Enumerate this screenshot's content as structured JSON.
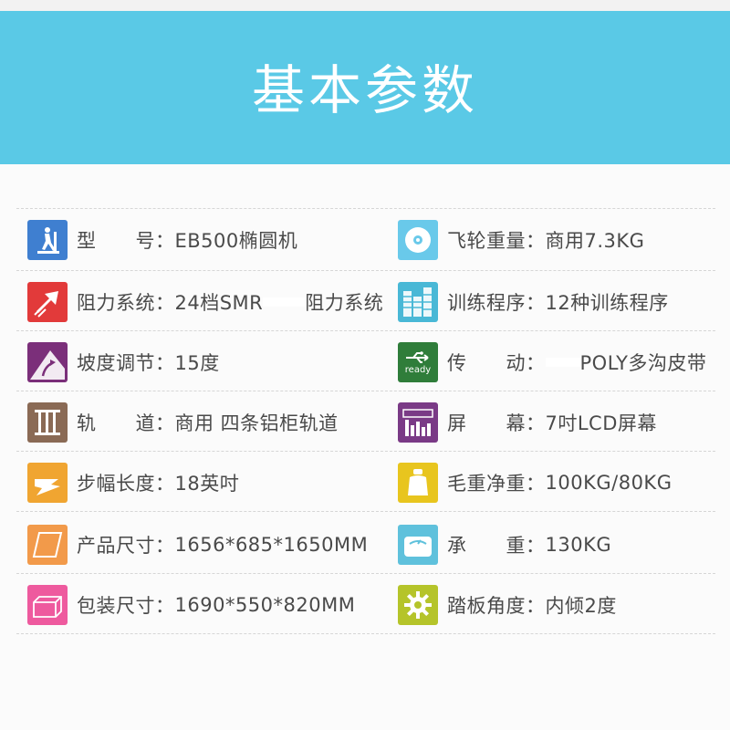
{
  "header": {
    "title": "基本参数"
  },
  "colors": {
    "banner": "#5ac9e6"
  },
  "left": [
    {
      "icon": "elliptical-machine-icon",
      "label": "型　　号：",
      "value": "EB500椭圆机"
    },
    {
      "icon": "resistance-arrow-icon",
      "label": "阻力系统：",
      "value": "24档SMR",
      "value2": "阻力系统"
    },
    {
      "icon": "incline-arrow-icon",
      "label": "坡度调节：",
      "value": "15度"
    },
    {
      "icon": "rail-icon",
      "label": "轨　　道：",
      "value": "商用 四条铝柜轨道"
    },
    {
      "icon": "stride-shoe-icon",
      "label": "步幅长度：",
      "value": "18英吋"
    },
    {
      "icon": "product-size-icon",
      "label": "产品尺寸：",
      "value": "1656*685*1650MM"
    },
    {
      "icon": "package-box-icon",
      "label": "包装尺寸：",
      "value": "1690*550*820MM"
    }
  ],
  "right": [
    {
      "icon": "flywheel-disc-icon",
      "label": "飞轮重量：",
      "value": "商用7.3KG"
    },
    {
      "icon": "training-program-icon",
      "label": "训练程序：",
      "value": "12种训练程序"
    },
    {
      "icon": "usb-ready-icon",
      "icon_text": "ready",
      "label": "传　　动：",
      "value": "POLY多沟皮带"
    },
    {
      "icon": "lcd-screen-icon",
      "label": "屏　　幕：",
      "value": "7吋LCD屏幕"
    },
    {
      "icon": "weight-icon",
      "label": "毛重净重：",
      "value": "100KG/80KG"
    },
    {
      "icon": "scale-icon",
      "label": "承　　重：",
      "value": "130KG"
    },
    {
      "icon": "gear-icon",
      "label": "踏板角度：",
      "value": "内倾2度"
    }
  ]
}
